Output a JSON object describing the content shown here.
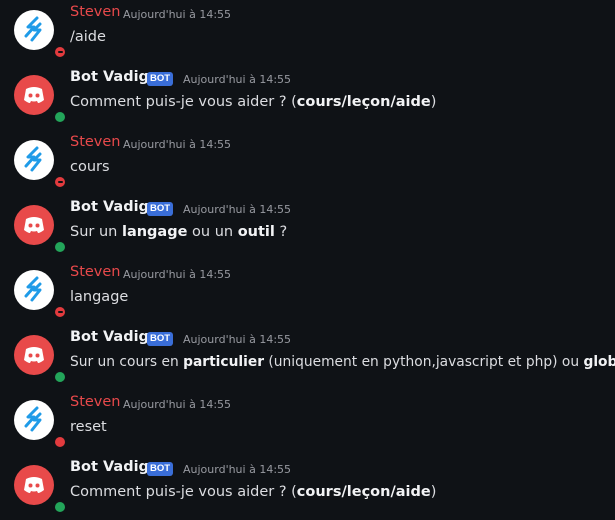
{
  "users": {
    "steven": {
      "name": "Steven",
      "status_color": "#e23b3e",
      "status": "dnd",
      "color": "#e8494b"
    },
    "bot": {
      "name": "Bot Vadiga",
      "badge": "BOT",
      "status_color": "#23a55a",
      "status": "online",
      "color": "#f2f3f5"
    }
  },
  "colors": {
    "bot_avatar_bg": "#e84a4a",
    "steven_avatar_bg": "#ffffff",
    "steven_logo": "#1f9be8",
    "background": "#0f1216"
  },
  "messages": [
    {
      "author": "Steven",
      "time": "Aujourd'hui à 14:55",
      "parts": [
        "/aide"
      ]
    },
    {
      "author": "Bot Vadiga",
      "badge": "BOT",
      "time": "Aujourd'hui à 14:55",
      "parts": [
        "Comment puis-je vous aider ? (",
        "cours",
        "/",
        "leçon",
        "/",
        "aide",
        ")"
      ]
    },
    {
      "author": "Steven",
      "time": "Aujourd'hui à 14:55",
      "parts": [
        "cours"
      ]
    },
    {
      "author": "Bot Vadiga",
      "badge": "BOT",
      "time": "Aujourd'hui à 14:55",
      "parts": [
        "Sur un ",
        "langage",
        " ou un ",
        "outil",
        " ?"
      ]
    },
    {
      "author": "Steven",
      "time": "Aujourd'hui à 14:55",
      "parts": [
        "langage"
      ]
    },
    {
      "author": "Bot Vadiga",
      "badge": "BOT",
      "time": "Aujourd'hui à 14:55",
      "parts": [
        "Sur un cours en ",
        "particulier",
        " (uniquement en python,javascript et php) ou ",
        "global",
        " ?"
      ]
    },
    {
      "author": "Steven",
      "time": "Aujourd'hui à 14:55",
      "parts": [
        "reset"
      ],
      "status_color": "#e23b3e"
    },
    {
      "author": "Bot Vadiga",
      "badge": "BOT",
      "time": "Aujourd'hui à 14:55",
      "parts": [
        "Comment puis-je vous aider ? (",
        "cours",
        "/",
        "leçon",
        "/",
        "aide",
        ")"
      ]
    }
  ]
}
